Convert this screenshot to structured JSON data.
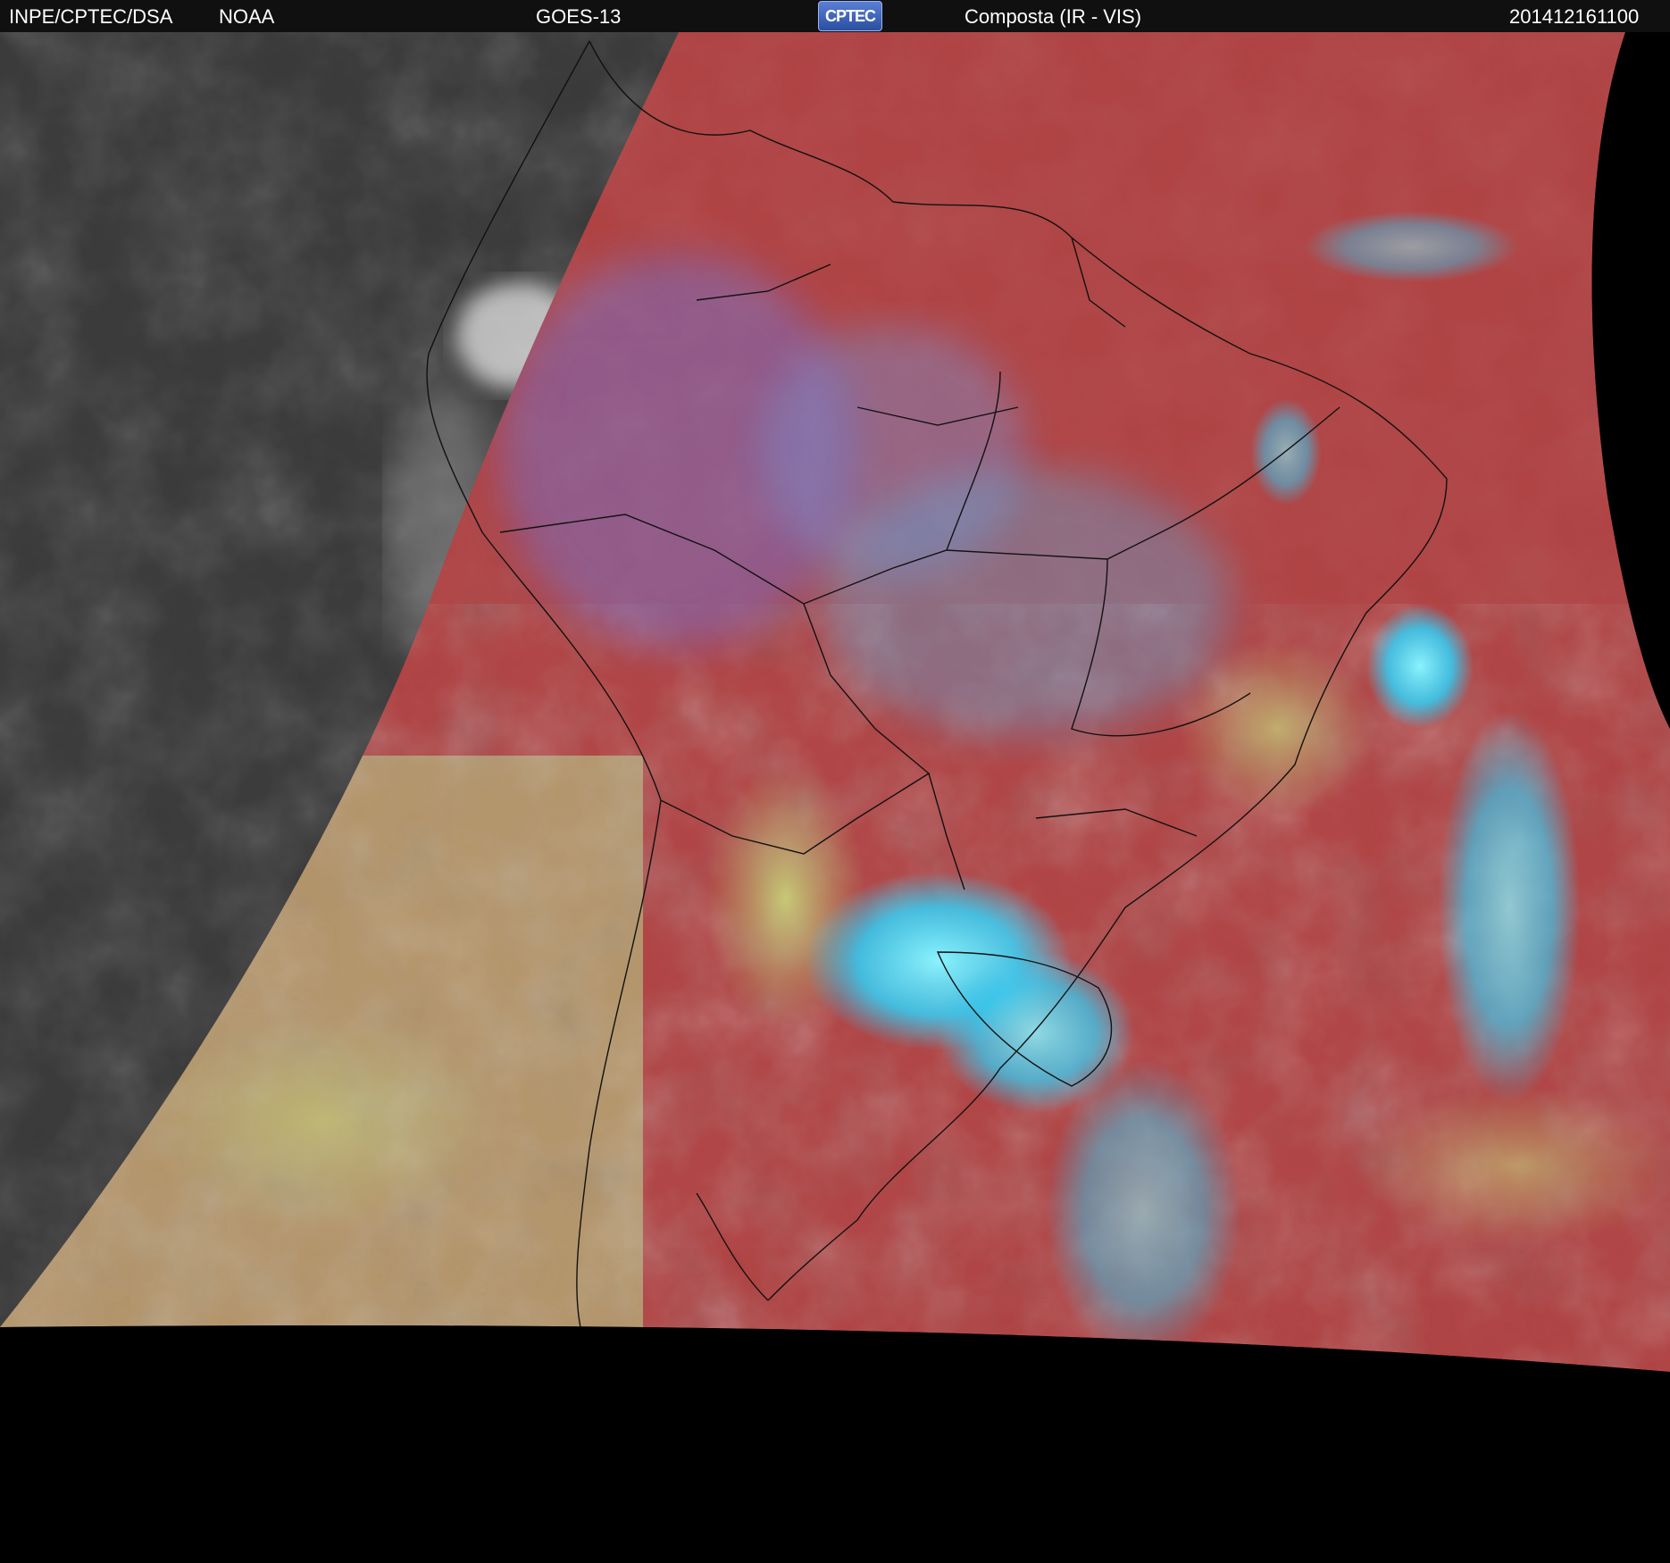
{
  "header": {
    "source": "INPE/CPTEC/DSA",
    "agency": "NOAA",
    "satellite": "GOES-13",
    "logo": "CPTEC",
    "product": "Composta (IR - VIS)",
    "timestamp": "201412161100"
  },
  "colors": {
    "background": "#000000",
    "header_bar": "#101010",
    "ir_gray": "#3a3a3a",
    "composite_red": "#b04445",
    "cloud_cyan": "#40d8f0",
    "cloud_green": "#9cc46a",
    "borders": "#111111"
  },
  "icons": {
    "logo": "cptec-logo"
  }
}
